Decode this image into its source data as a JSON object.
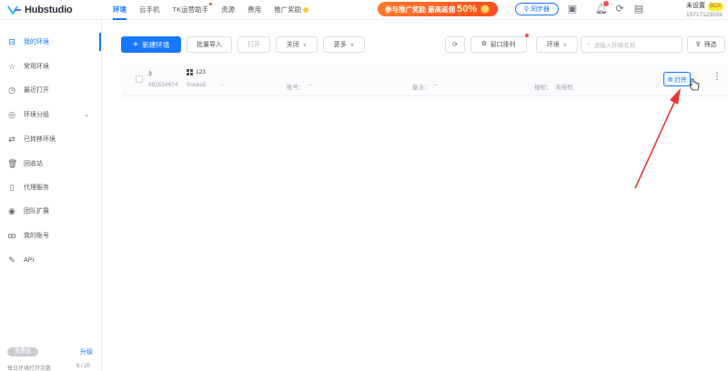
{
  "app": {
    "logo_text": "Hubstudio"
  },
  "nav": {
    "items": [
      {
        "label": "环境",
        "active": true
      },
      {
        "label": "云手机"
      },
      {
        "label": "TK运营助手",
        "dot": true
      },
      {
        "label": "资源"
      },
      {
        "label": "费用"
      },
      {
        "label": "推广奖励",
        "coin": true
      }
    ]
  },
  "promo": {
    "text": "参与推广奖励 最高返佣",
    "percent": "50%"
  },
  "header": {
    "sync_label": "同步器",
    "user_name": "未设置",
    "vip": "BOX",
    "phone": "15717123559"
  },
  "sidebar": {
    "items": [
      {
        "label": "我的环境",
        "icon": "monitor-icon"
      },
      {
        "label": "常用环境",
        "icon": "star-icon"
      },
      {
        "label": "最近打开",
        "icon": "clock-icon"
      },
      {
        "label": "环境分组",
        "icon": "folder-icon"
      },
      {
        "label": "已转移环境",
        "icon": "transfer-icon"
      },
      {
        "label": "回收站",
        "icon": "trash-icon"
      },
      {
        "label": "代理服务",
        "icon": "proxy-icon"
      },
      {
        "label": "团队扩展",
        "icon": "team-icon"
      },
      {
        "label": "我的账号",
        "icon": "user-icon"
      },
      {
        "label": "API",
        "icon": "api-icon"
      }
    ],
    "plan_label": "免费版",
    "upgrade_label": "升级",
    "quota_label": "每日环境打开次数",
    "quota_value": "6 / 20"
  },
  "toolbar": {
    "new_env": "新建环境",
    "batch_import": "批量导入",
    "open": "打开",
    "close": "关闭",
    "more": "更多",
    "window_sync": "窗口排列",
    "env_filter": "环境",
    "search_placeholder": "请输入环境名称",
    "filter": "筛选"
  },
  "rows": [
    {
      "serial": "3",
      "id": "891554674",
      "name": "123",
      "proxy": "Socks5",
      "proxy_value": "--",
      "account_label": "账号：",
      "account_value": "--",
      "note_label": "备注：",
      "note_value": "--",
      "auth_label": "授权：",
      "auth_value": "未授权",
      "open_label": "打开"
    }
  ],
  "colors": {
    "accent": "#1677ff",
    "annotation": "#e53935"
  }
}
